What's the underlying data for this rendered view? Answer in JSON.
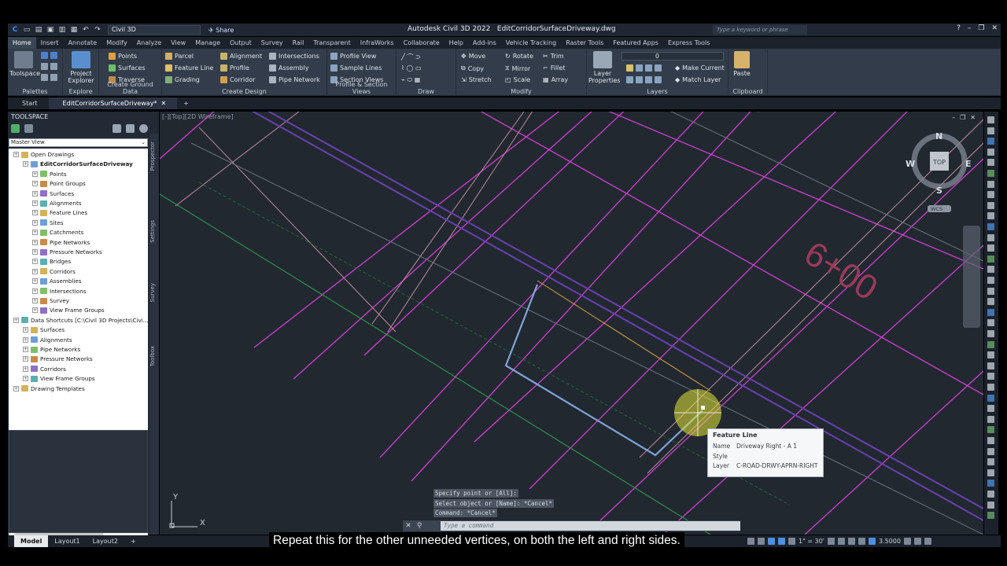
{
  "app": {
    "workspace": "Civil 3D",
    "share_label": "Share",
    "title": "Autodesk Civil 3D 2022",
    "filename": "EditCorridorSurfaceDriveway.dwg",
    "search_placeholder": "Type a keyword or phrase"
  },
  "ribbon_tabs": [
    "Home",
    "Insert",
    "Annotate",
    "Modify",
    "Analyze",
    "View",
    "Manage",
    "Output",
    "Survey",
    "Rail",
    "Transparent",
    "InfraWorks",
    "Collaborate",
    "Help",
    "Add-ins",
    "Vehicle Tracking",
    "Raster Tools",
    "Featured Apps",
    "Express Tools"
  ],
  "ribbon": {
    "toolspace": "Toolspace",
    "project_explorer_1": "Project",
    "project_explorer_2": "Explorer",
    "points": "Points",
    "surfaces": "Surfaces",
    "traverse": "Traverse",
    "parcel": "Parcel",
    "feature_line": "Feature Line",
    "grading": "Grading",
    "alignment": "Alignment",
    "profile": "Profile",
    "corridor": "Corridor",
    "intersections": "Intersections",
    "assembly": "Assembly",
    "pipe_network": "Pipe Network",
    "profile_view": "Profile View",
    "sample_lines": "Sample Lines",
    "section_views": "Section Views",
    "move": "Move",
    "copy": "Copy",
    "stretch": "Stretch",
    "rotate": "Rotate",
    "mirror": "Mirror",
    "scale": "Scale",
    "trim": "Trim",
    "fillet": "Fillet",
    "array": "Array",
    "layer_properties_1": "Layer",
    "layer_properties_2": "Properties",
    "layer_value": "0",
    "make_current": "Make Current",
    "match_layer": "Match Layer",
    "paste": "Paste",
    "groups": {
      "palettes": "Palettes",
      "explore": "Explore",
      "create_ground_data": "Create Ground Data",
      "create_design": "Create Design",
      "profile_section_views": "Profile & Section Views",
      "draw": "Draw",
      "modify": "Modify",
      "layers": "Layers",
      "clipboard": "Clipboard"
    }
  },
  "doc_tabs": {
    "start": "Start",
    "active": "EditCorridorSurfaceDriveway*"
  },
  "toolspace": {
    "title": "TOOLSPACE",
    "view": "Master View",
    "tree": [
      {
        "label": "Open Drawings",
        "level": 0
      },
      {
        "label": "EditCorridorSurfaceDriveway",
        "level": 1,
        "bold": true
      },
      {
        "label": "Points",
        "level": 2
      },
      {
        "label": "Point Groups",
        "level": 2
      },
      {
        "label": "Surfaces",
        "level": 2
      },
      {
        "label": "Alignments",
        "level": 2
      },
      {
        "label": "Feature Lines",
        "level": 2
      },
      {
        "label": "Sites",
        "level": 2
      },
      {
        "label": "Catchments",
        "level": 2
      },
      {
        "label": "Pipe Networks",
        "level": 2
      },
      {
        "label": "Pressure Networks",
        "level": 2
      },
      {
        "label": "Bridges",
        "level": 2
      },
      {
        "label": "Corridors",
        "level": 2
      },
      {
        "label": "Assemblies",
        "level": 2
      },
      {
        "label": "Intersections",
        "level": 2
      },
      {
        "label": "Survey",
        "level": 2
      },
      {
        "label": "View Frame Groups",
        "level": 2
      },
      {
        "label": "Data Shortcuts [C:\\Civil 3D Projects\\Civi...",
        "level": 0
      },
      {
        "label": "Surfaces",
        "level": 1
      },
      {
        "label": "Alignments",
        "level": 1
      },
      {
        "label": "Pipe Networks",
        "level": 1
      },
      {
        "label": "Pressure Networks",
        "level": 1
      },
      {
        "label": "Corridors",
        "level": 1
      },
      {
        "label": "View Frame Groups",
        "level": 1
      },
      {
        "label": "Drawing Templates",
        "level": 0
      }
    ],
    "side_tabs": [
      "Prospector",
      "Settings",
      "Survey",
      "Toolbox"
    ]
  },
  "viewport": {
    "label": "[-][Top][2D Wireframe]",
    "station_text": "6+00",
    "compass": {
      "n": "N",
      "s": "S",
      "e": "E",
      "w": "W",
      "top": "TOP",
      "ucs": "WCS"
    },
    "ucs_x": "X",
    "ucs_y": "Y"
  },
  "tooltip": {
    "title": "Feature Line",
    "name_key": "Name",
    "name_val": "Driveway Right - A 1",
    "style_key": "Style",
    "style_val": "",
    "layer_key": "Layer",
    "layer_val": "C-ROAD-DRWY-APRN-RIGHT"
  },
  "command": {
    "history": [
      "Specify point or [All]:",
      "Select object or [Name]: *Cancel*",
      "Command: *Cancel*"
    ],
    "placeholder": "Type a command"
  },
  "status": {
    "tabs": [
      "Model",
      "Layout1",
      "Layout2"
    ],
    "scale": "1\" = 30'",
    "value": "3.5000"
  },
  "caption": "Repeat this for the other unneeded vertices, on both the left and right sides.",
  "colors": {
    "magenta": "#d63cd6",
    "pink": "#c98aa8",
    "purple": "#6d3fa8",
    "blue_line": "#6a7ec8",
    "green": "#2fa84f",
    "gray": "#6c7480"
  }
}
